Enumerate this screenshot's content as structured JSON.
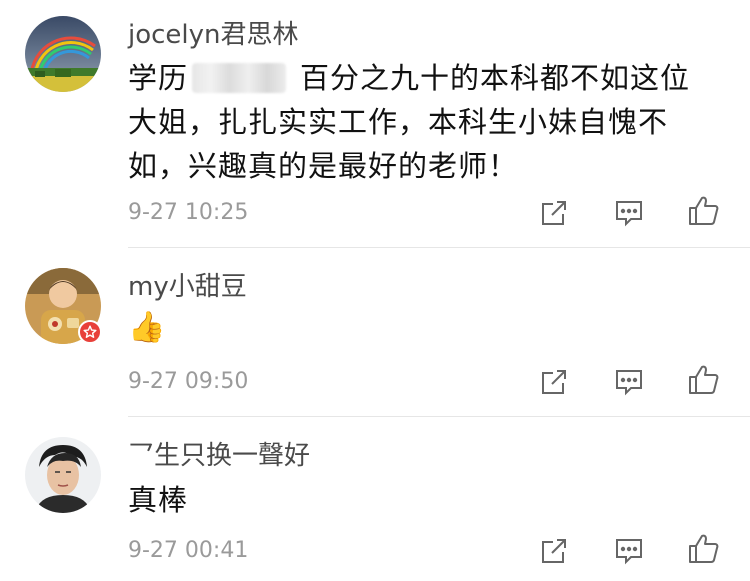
{
  "comments": [
    {
      "username": "jocelyn君思林",
      "text_before_blur": "学历",
      "text_after_blur": "百分之九十的本科都不如这位大姐，扎扎实实工作，本科生小妹自愧不如，兴趣真的是最好的老师！",
      "time": "9-27 10:25",
      "avatar_icon": "rainbow-landscape-avatar",
      "badge": null
    },
    {
      "username": "my小甜豆",
      "text": "👍",
      "time": "9-27 09:50",
      "avatar_icon": "child-photo-avatar",
      "badge": "verified-star-badge"
    },
    {
      "username": "乛生只换一聲好",
      "text": "真棒",
      "time": "9-27 00:41",
      "avatar_icon": "man-portrait-avatar",
      "badge": null
    }
  ],
  "actions": [
    "share-icon",
    "comment-icon",
    "like-icon"
  ],
  "colors": {
    "username": "#4a4a4a",
    "text": "#111111",
    "time": "#9a9a9a",
    "icon": "#666666",
    "badge": "#e8403a",
    "divider": "#e6e6e6"
  }
}
